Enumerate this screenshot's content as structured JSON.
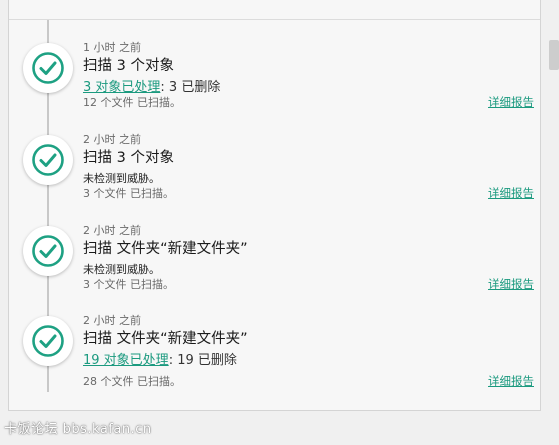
{
  "entries": [
    {
      "time": "1 小时 之前",
      "title": "扫描 3 个对象",
      "processed_link": "3 对象已处理",
      "processed_rest": ": 3 已删除",
      "files": "12 个文件 已扫描。",
      "report": "详细报告"
    },
    {
      "time": "2 小时 之前",
      "title": "扫描 3 个对象",
      "status": "未检测到威胁。",
      "files": "3 个文件 已扫描。",
      "report": "详细报告"
    },
    {
      "time": "2 小时 之前",
      "title": "扫描 文件夹“新建文件夹”",
      "status": "未检测到威胁。",
      "files": "3 个文件 已扫描。",
      "report": "详细报告"
    },
    {
      "time": "2 小时 之前",
      "title": "扫描 文件夹“新建文件夹”",
      "processed_link": "19 对象已处理",
      "processed_rest": ": 19 已删除",
      "files": "28 个文件 已扫描。",
      "report": "详细报告"
    }
  ],
  "watermark": "卡饭论坛 bbs.kafan.cn",
  "colors": {
    "accent": "#1b9a7f",
    "check": "#1ea183"
  },
  "icons": {
    "status": "check-circle-icon"
  }
}
